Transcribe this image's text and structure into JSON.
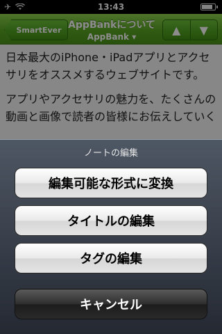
{
  "status_bar": {
    "time": "13:43"
  },
  "nav": {
    "back_label": "SmartEver",
    "title": "AppBankについて",
    "subtitle": "AppBank ▾"
  },
  "content": {
    "paragraph1": "日本最大のiPhone・iPadアプリとアクセサリをオススメするウェブサイトです。",
    "paragraph2": "アプリやアクセサリの魅力を、たくさんの動画と画像で読者の皆様にお伝えしていく"
  },
  "action_sheet": {
    "title": "ノートの編集",
    "buttons": [
      "編集可能な形式に変換",
      "タイトルの編集",
      "タグの編集"
    ],
    "cancel_label": "キャンセル"
  }
}
